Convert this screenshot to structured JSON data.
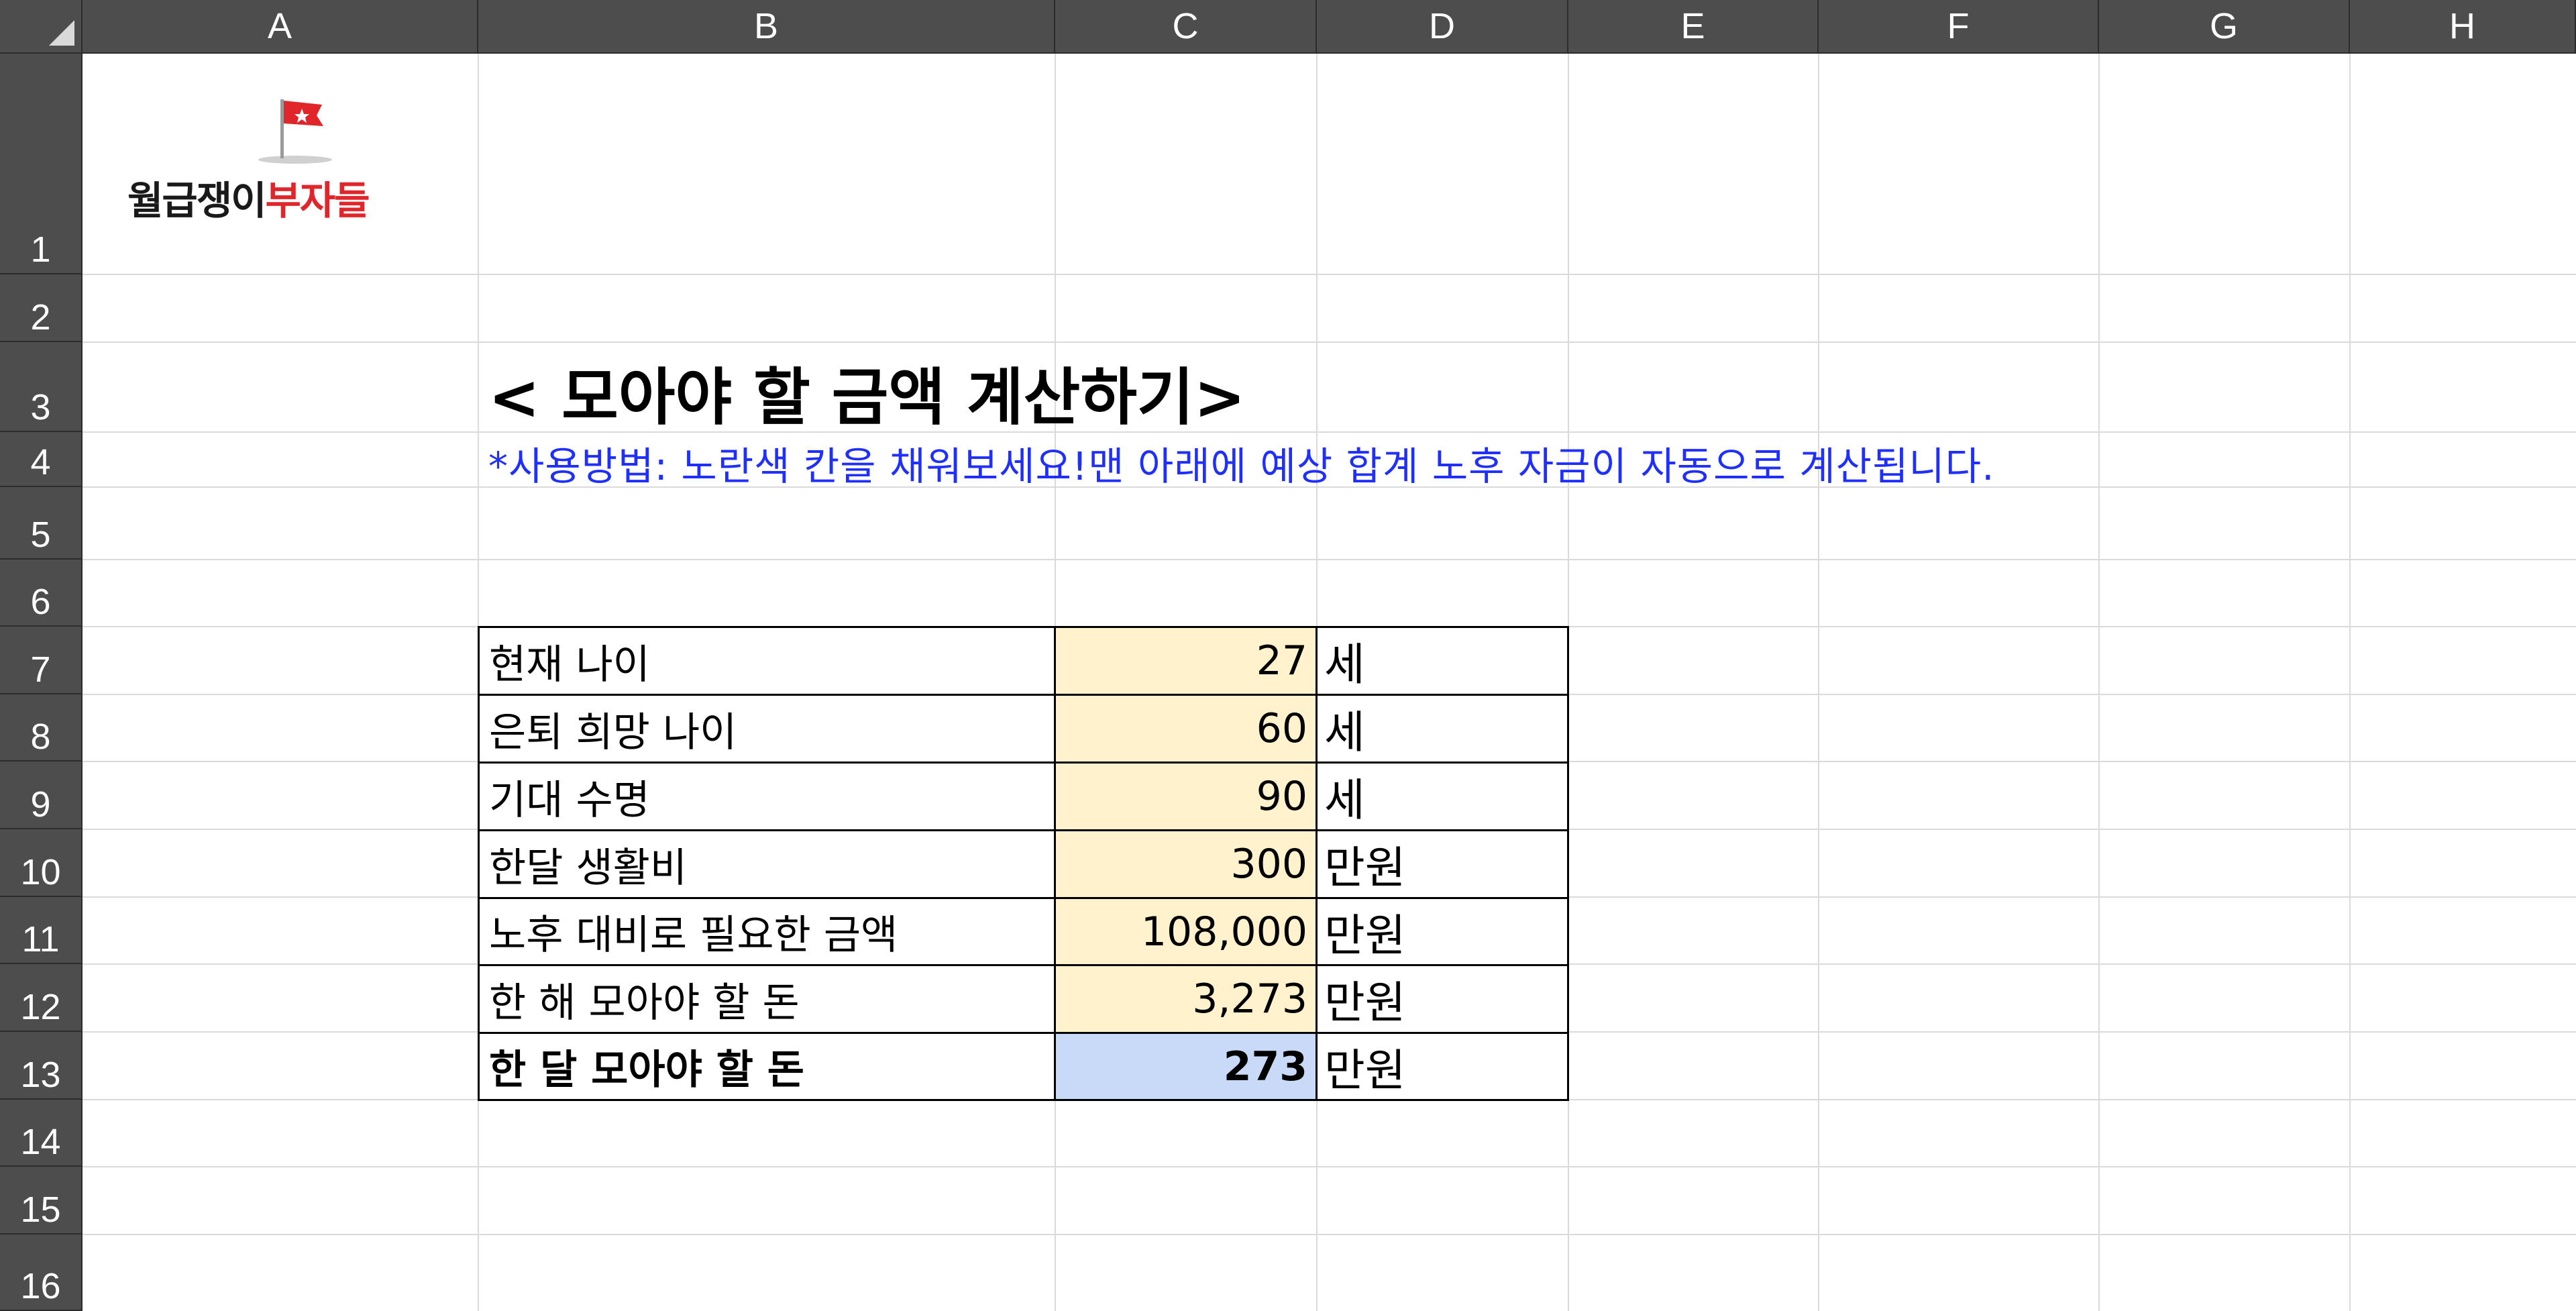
{
  "columns": [
    "A",
    "B",
    "C",
    "D",
    "E",
    "F",
    "G",
    "H"
  ],
  "rows": [
    "1",
    "2",
    "3",
    "4",
    "5",
    "6",
    "7",
    "8",
    "9",
    "10",
    "11",
    "12",
    "13",
    "14",
    "15",
    "16"
  ],
  "logo": {
    "text_dark": "월급쟁이",
    "text_red": "부자들"
  },
  "title": "< 모아야 할 금액 계산하기>",
  "instruction": "*사용방법: 노란색 칸을 채워보세요!맨 아래에 예상 합계 노후 자금이 자동으로 계산됩니다.",
  "table": [
    {
      "label": "현재 나이",
      "value": "27",
      "unit": "세"
    },
    {
      "label": "은퇴 희망 나이",
      "value": "60",
      "unit": "세"
    },
    {
      "label": "기대 수명",
      "value": "90",
      "unit": "세"
    },
    {
      "label": "한달 생활비",
      "value": "300",
      "unit": "만원"
    },
    {
      "label": "노후 대비로 필요한 금액",
      "value": "108,000",
      "unit": "만원"
    },
    {
      "label": "한 해 모아야 할 돈",
      "value": "3,273",
      "unit": "만원"
    },
    {
      "label": "한 달 모아야 할 돈",
      "value": "273",
      "unit": "만원"
    }
  ],
  "colors": {
    "header_bg": "#4d4d4d",
    "input_cell": "#fff2cc",
    "result_cell": "#c9daf8",
    "instruction_text": "#1f2fff",
    "logo_red": "#e0262b"
  }
}
